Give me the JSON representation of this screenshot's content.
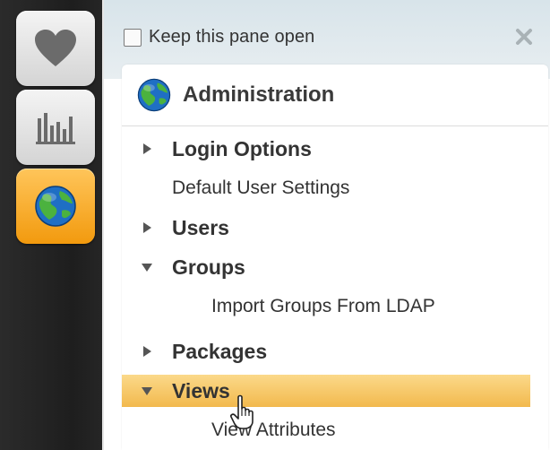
{
  "rail": {
    "buttons": [
      {
        "icon": "heart-icon",
        "active": false
      },
      {
        "icon": "bar-chart-icon",
        "active": false
      },
      {
        "icon": "globe-icon",
        "active": true
      }
    ]
  },
  "pane": {
    "keep_open_label": "Keep this pane open",
    "keep_open_checked": false,
    "close_icon": "close-icon",
    "section_title": "Administration",
    "section_icon": "globe-icon",
    "items": [
      {
        "label": "Login Options",
        "type": "collapsed"
      },
      {
        "label": "Default User Settings",
        "type": "plain"
      },
      {
        "label": "Users",
        "type": "collapsed"
      },
      {
        "label": "Groups",
        "type": "expanded"
      },
      {
        "label": "Import Groups From LDAP",
        "type": "child"
      },
      {
        "label": "Packages",
        "type": "collapsed"
      },
      {
        "label": "Views",
        "type": "expanded-selected"
      },
      {
        "label": "View Attributes",
        "type": "child"
      }
    ]
  },
  "colors": {
    "rail": "#222222",
    "active_button": "#f5a623",
    "selected_row": "#f4c05e",
    "header": "#dfe8ec"
  }
}
